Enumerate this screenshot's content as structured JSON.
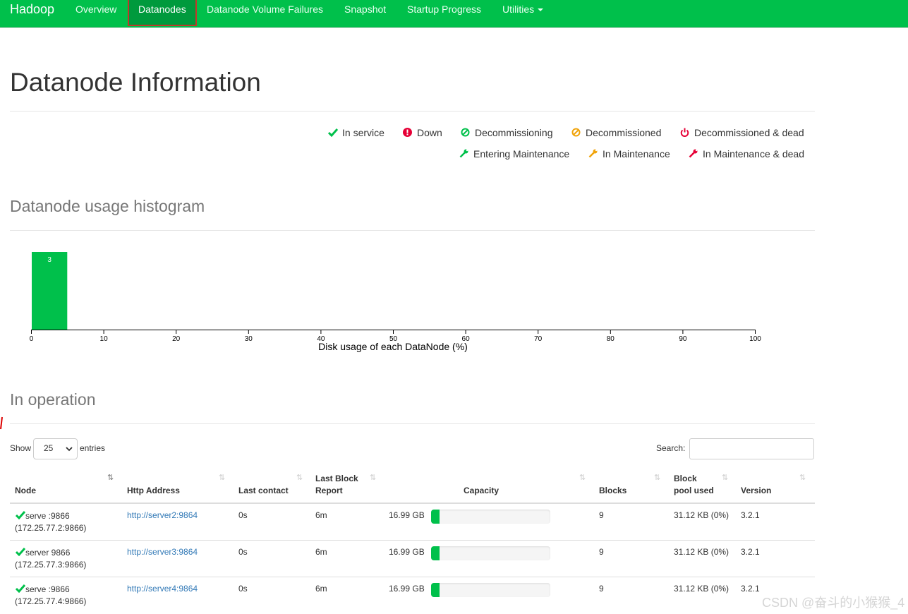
{
  "navbar": {
    "brand": "Hadoop",
    "items": [
      "Overview",
      "Datanodes",
      "Datanode Volume Failures",
      "Snapshot",
      "Startup Progress",
      "Utilities"
    ]
  },
  "page_title": "Datanode Information",
  "legend": {
    "in_service": "In service",
    "down": "Down",
    "decommissioning": "Decommissioning",
    "decommissioned": "Decommissioned",
    "decommissioned_dead": "Decommissioned & dead",
    "entering_maintenance": "Entering Maintenance",
    "in_maintenance": "In Maintenance",
    "in_maintenance_dead": "In Maintenance & dead"
  },
  "colors": {
    "accent": "#00c04b",
    "danger": "#e60036",
    "warning": "#f0a30a",
    "link": "#337ab7"
  },
  "histogram_title": "Datanode usage histogram",
  "chart_data": {
    "type": "bar",
    "xlabel": "Disk usage of each DataNode (%)",
    "xlim": [
      0,
      100
    ],
    "xticks": [
      "0",
      "10",
      "20",
      "30",
      "40",
      "50",
      "60",
      "70",
      "80",
      "90",
      "100"
    ],
    "bins": [
      {
        "from": 0,
        "to": 5,
        "count": 3,
        "label": "3"
      }
    ]
  },
  "operation_title": "In operation",
  "controls": {
    "show_label": "Show",
    "page_size": "25",
    "entries_label": "entries",
    "search_label": "Search:"
  },
  "table": {
    "headers": {
      "node": "Node",
      "http": "Http Address",
      "contact_line1": "Last contact",
      "block_report_line1": "Last Block",
      "block_report_line2": "Report",
      "capacity": "Capacity",
      "blocks": "Blocks",
      "pool_line1": "Block",
      "pool_line2": "pool used",
      "version": "Version"
    },
    "rows": [
      {
        "node": "serve  :9866",
        "node_ip": "(172.25.77.2:9866)",
        "http": "http://server2:9864",
        "last_contact": "0s",
        "last_block_report": "6m",
        "capacity": "16.99 GB",
        "used_fraction": 0.07,
        "blocks": "9",
        "pool_used": "31.12 KB (0%)",
        "version": "3.2.1"
      },
      {
        "node": "server  9866",
        "node_ip": "(172.25.77.3:9866)",
        "http": "http://server3:9864",
        "last_contact": "0s",
        "last_block_report": "6m",
        "capacity": "16.99 GB",
        "used_fraction": 0.07,
        "blocks": "9",
        "pool_used": "31.12 KB (0%)",
        "version": "3.2.1"
      },
      {
        "node": "serve  :9866",
        "node_ip": "(172.25.77.4:9866)",
        "http": "http://server4:9864",
        "last_contact": "0s",
        "last_block_report": "6m",
        "capacity": "16.99 GB",
        "used_fraction": 0.07,
        "blocks": "9",
        "pool_used": "31.12 KB (0%)",
        "version": "3.2.1"
      }
    ]
  },
  "watermark": "CSDN @奋斗的小猴猴_4"
}
